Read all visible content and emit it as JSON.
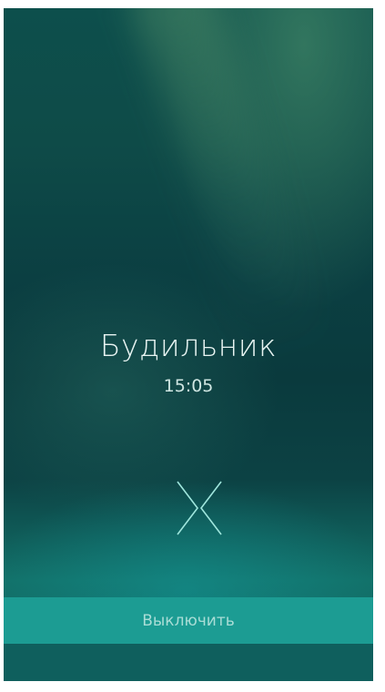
{
  "alarm": {
    "title": "Будильник",
    "time": "15:05"
  },
  "actions": {
    "dismiss_label": "Выключить"
  },
  "icons": {
    "swipe": "swipe-dismiss-chevrons-icon"
  },
  "colors": {
    "accent": "#1c9c93",
    "text": "#e8f4f2"
  }
}
